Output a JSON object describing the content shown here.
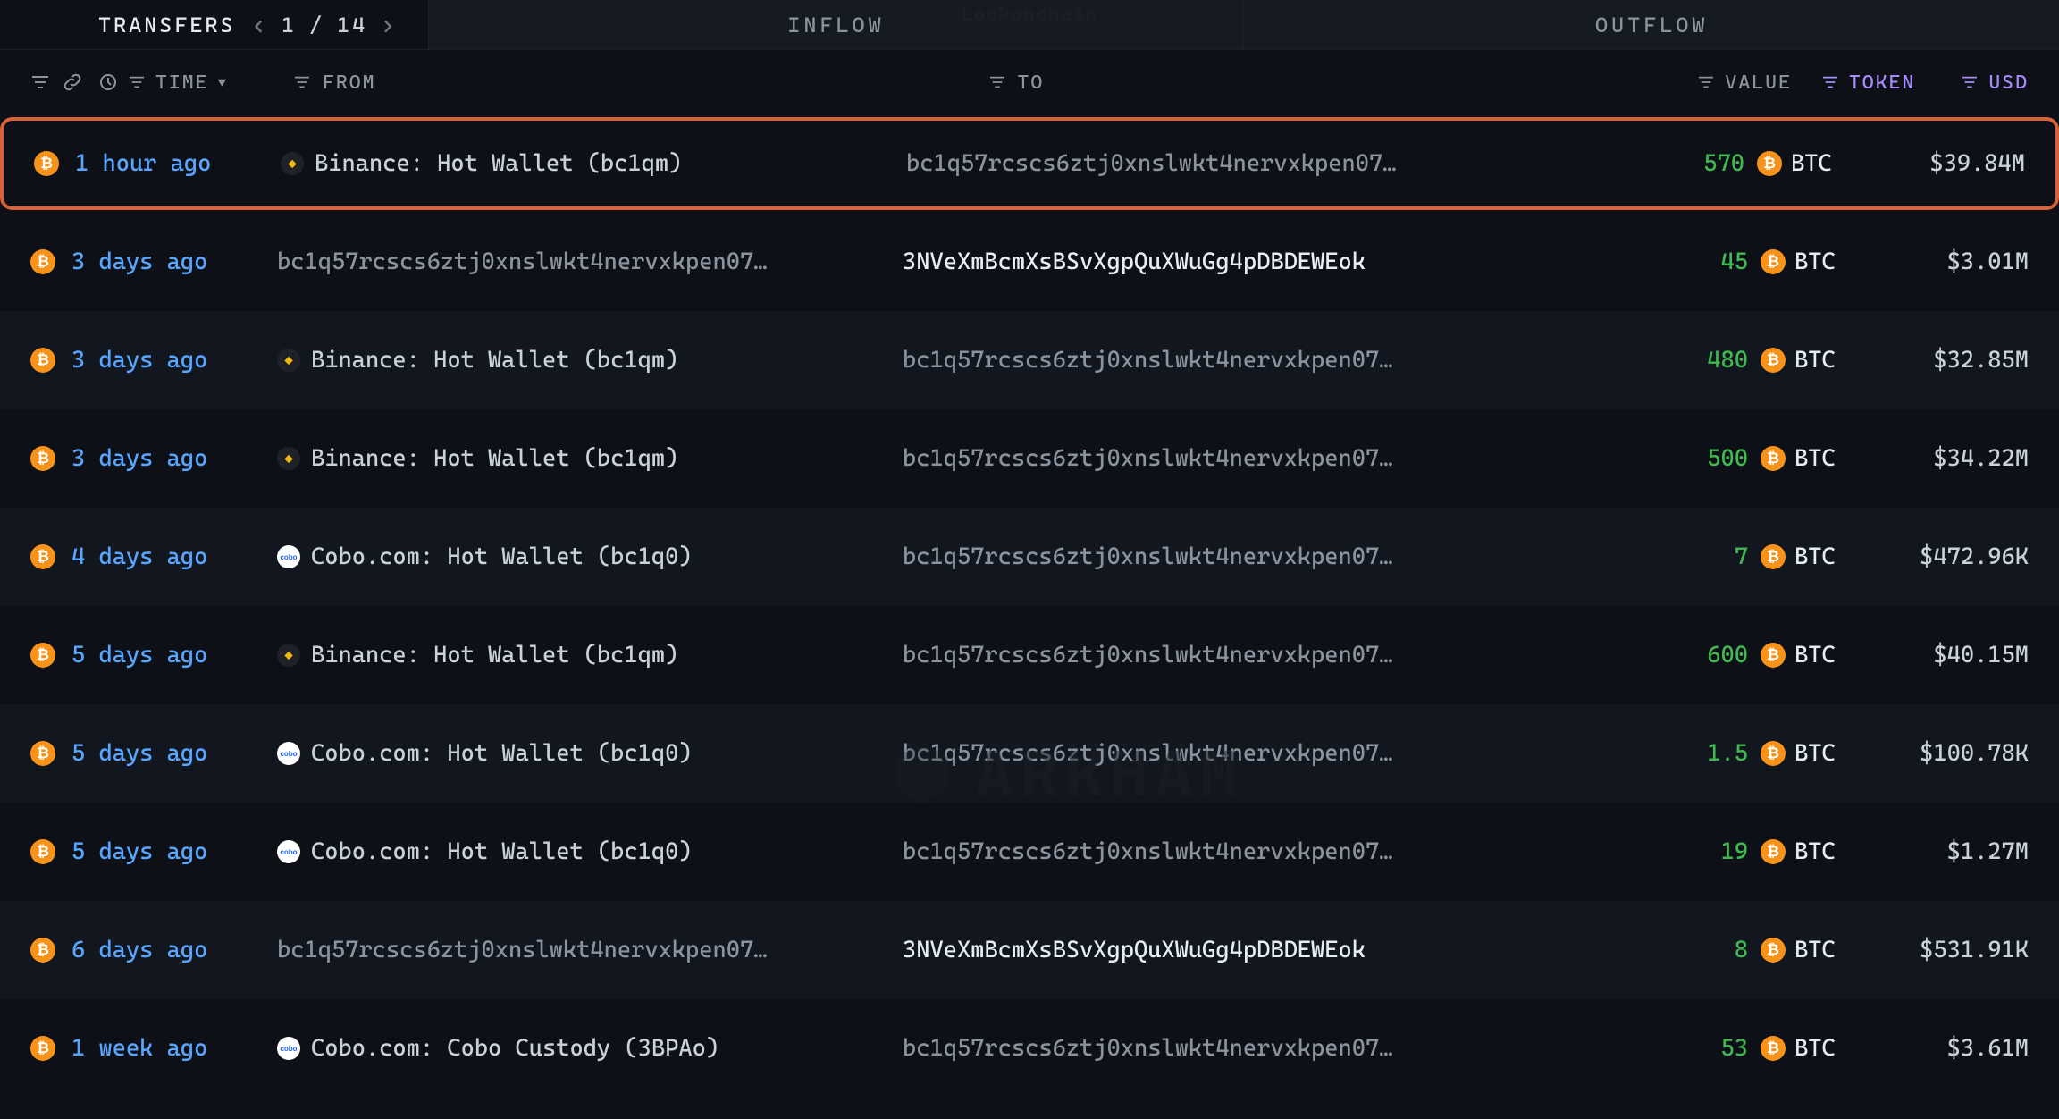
{
  "watermark_top": "Lookonchain",
  "watermark_center": "ARKHAM",
  "tabs": {
    "transfers": "TRANSFERS",
    "inflow": "INFLOW",
    "outflow": "OUTFLOW"
  },
  "pager": {
    "current": "1",
    "separator": "/",
    "total": "14"
  },
  "headers": {
    "time": "TIME",
    "from": "FROM",
    "to": "TO",
    "value": "VALUE",
    "token": "TOKEN",
    "usd": "USD"
  },
  "rows": [
    {
      "time": "1 hour ago",
      "from_entity": "binance",
      "from_label": "Binance: Hot Wallet (bc1qm)",
      "from_gray": false,
      "to": "bc1q57rcscs6ztj0xnslwkt4nervxkpen07…",
      "to_light": false,
      "value": "570",
      "token": "BTC",
      "usd": "$39.84M",
      "highlight": true,
      "alt": false
    },
    {
      "time": "3 days ago",
      "from_entity": null,
      "from_label": "bc1q57rcscs6ztj0xnslwkt4nervxkpen07…",
      "from_gray": true,
      "to": "3NVeXmBcmXsBSvXgpQuXWuGg4pDBDEWEok",
      "to_light": true,
      "value": "45",
      "token": "BTC",
      "usd": "$3.01M",
      "highlight": false,
      "alt": false
    },
    {
      "time": "3 days ago",
      "from_entity": "binance",
      "from_label": "Binance: Hot Wallet (bc1qm)",
      "from_gray": false,
      "to": "bc1q57rcscs6ztj0xnslwkt4nervxkpen07…",
      "to_light": false,
      "value": "480",
      "token": "BTC",
      "usd": "$32.85M",
      "highlight": false,
      "alt": true
    },
    {
      "time": "3 days ago",
      "from_entity": "binance",
      "from_label": "Binance: Hot Wallet (bc1qm)",
      "from_gray": false,
      "to": "bc1q57rcscs6ztj0xnslwkt4nervxkpen07…",
      "to_light": false,
      "value": "500",
      "token": "BTC",
      "usd": "$34.22M",
      "highlight": false,
      "alt": false
    },
    {
      "time": "4 days ago",
      "from_entity": "cobo",
      "from_label": "Cobo.com: Hot Wallet (bc1q0)",
      "from_gray": false,
      "to": "bc1q57rcscs6ztj0xnslwkt4nervxkpen07…",
      "to_light": false,
      "value": "7",
      "token": "BTC",
      "usd": "$472.96K",
      "highlight": false,
      "alt": true
    },
    {
      "time": "5 days ago",
      "from_entity": "binance",
      "from_label": "Binance: Hot Wallet (bc1qm)",
      "from_gray": false,
      "to": "bc1q57rcscs6ztj0xnslwkt4nervxkpen07…",
      "to_light": false,
      "value": "600",
      "token": "BTC",
      "usd": "$40.15M",
      "highlight": false,
      "alt": false
    },
    {
      "time": "5 days ago",
      "from_entity": "cobo",
      "from_label": "Cobo.com: Hot Wallet (bc1q0)",
      "from_gray": false,
      "to": "bc1q57rcscs6ztj0xnslwkt4nervxkpen07…",
      "to_light": false,
      "value": "1.5",
      "token": "BTC",
      "usd": "$100.78K",
      "highlight": false,
      "alt": true
    },
    {
      "time": "5 days ago",
      "from_entity": "cobo",
      "from_label": "Cobo.com: Hot Wallet (bc1q0)",
      "from_gray": false,
      "to": "bc1q57rcscs6ztj0xnslwkt4nervxkpen07…",
      "to_light": false,
      "value": "19",
      "token": "BTC",
      "usd": "$1.27M",
      "highlight": false,
      "alt": false
    },
    {
      "time": "6 days ago",
      "from_entity": null,
      "from_label": "bc1q57rcscs6ztj0xnslwkt4nervxkpen07…",
      "from_gray": true,
      "to": "3NVeXmBcmXsBSvXgpQuXWuGg4pDBDEWEok",
      "to_light": true,
      "value": "8",
      "token": "BTC",
      "usd": "$531.91K",
      "highlight": false,
      "alt": true
    },
    {
      "time": "1 week ago",
      "from_entity": "cobo",
      "from_label": "Cobo.com: Cobo Custody (3BPAo)",
      "from_gray": false,
      "to": "bc1q57rcscs6ztj0xnslwkt4nervxkpen07…",
      "to_light": false,
      "value": "53",
      "token": "BTC",
      "usd": "$3.61M",
      "highlight": false,
      "alt": false
    }
  ]
}
